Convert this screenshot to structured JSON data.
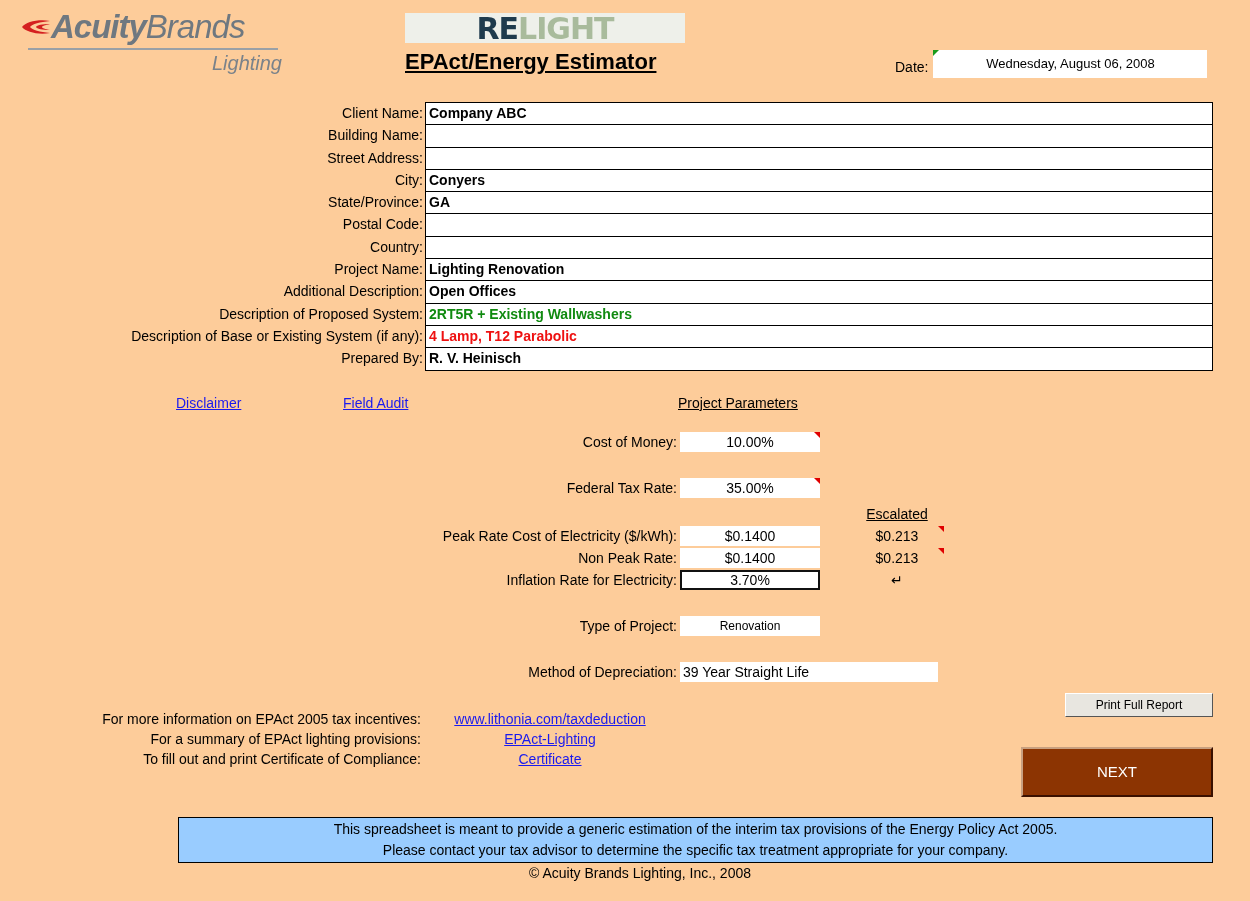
{
  "logo": {
    "brand_bold": "Acuity",
    "brand_light": "Brands",
    "division": "Lighting"
  },
  "product_logo": {
    "part_1": "RE",
    "part_2": "LIGHT"
  },
  "title": "EPAct/Energy Estimator",
  "date": {
    "label": "Date:",
    "value": "Wednesday, August 06, 2008",
    "comment": true
  },
  "client_fields": [
    {
      "label": "Client Name:",
      "value": "Company ABC",
      "color": "#000000"
    },
    {
      "label": "Building Name:"
    },
    {
      "label": "Street Address:"
    },
    {
      "label": "City:",
      "value": "Conyers",
      "color": "#000000"
    },
    {
      "label": "State/Province:",
      "value": "GA",
      "color": "#000000"
    },
    {
      "label": "Postal Code:"
    },
    {
      "label": "Country:"
    },
    {
      "label": "Project Name:",
      "value": "Lighting Renovation",
      "color": "#000000"
    },
    {
      "label": "Additional Description:",
      "value": "Open Offices",
      "color": "#000000"
    },
    {
      "label": "Description of Proposed System:",
      "value": "2RT5R + Existing Wallwashers",
      "color": "#108a10"
    },
    {
      "label": "Description of Base or Existing System (if any):",
      "value": "4 Lamp, T12 Parabolic",
      "color": "#ee1111"
    },
    {
      "label": "Prepared By:",
      "value": "R. V. Heinisch",
      "color": "#000000"
    }
  ],
  "links": [
    "Disclaimer",
    "Field Audit"
  ],
  "parameters_heading": "Project Parameters",
  "parameter_groups": [
    {
      "rows": [
        {
          "kind": "box",
          "label": "Cost of Money:",
          "value": "10.00%",
          "comment": true,
          "selected": false
        }
      ]
    },
    {
      "rows": [
        {
          "kind": "box",
          "label": "Federal Tax Rate:",
          "value": "35.00%",
          "comment": true,
          "selected": false
        }
      ]
    },
    {
      "escalated_heading": "Escalated",
      "rows": [
        {
          "kind": "box",
          "label": "Peak Rate Cost of Electricity ($/kWh):",
          "value": "$0.1400",
          "selected": false,
          "escalated": "$0.213",
          "escalated_comment": true
        },
        {
          "kind": "box",
          "label": "Non Peak Rate:",
          "value": "$0.1400",
          "selected": false,
          "escalated": "$0.213",
          "escalated_comment": true
        },
        {
          "kind": "box",
          "label": "Inflation Rate for Electricity:",
          "value": "3.70%",
          "selected": true,
          "escalated": "↵"
        }
      ]
    },
    {
      "rows": [
        {
          "kind": "small",
          "label": "Type of Project:",
          "value": "Renovation",
          "selected": false
        }
      ]
    },
    {
      "rows": [
        {
          "kind": "wide",
          "label": "Method of Depreciation:",
          "value": "39 Year Straight Life",
          "selected": false
        }
      ]
    }
  ],
  "info_rows": [
    {
      "label": "For more information on EPAct 2005 tax incentives:",
      "link": "www.lithonia.com/taxdeduction"
    },
    {
      "label": "For a summary of EPAct  lighting provisions:",
      "link": "EPAct-Lighting"
    },
    {
      "label": "To fill out and print Certificate of Compliance:",
      "link": "Certificate"
    }
  ],
  "buttons": [
    {
      "kind": "standard",
      "label": "Print Full Report"
    },
    {
      "kind": "primary",
      "label": "NEXT"
    }
  ],
  "notice": [
    "This spreadsheet is meant to provide a generic estimation of the interim tax provisions of the Energy Policy Act 2005.",
    "Please contact your tax advisor to determine the specific tax treatment appropriate for your company."
  ],
  "copyright": "© Acuity Brands Lighting, Inc., 2008"
}
